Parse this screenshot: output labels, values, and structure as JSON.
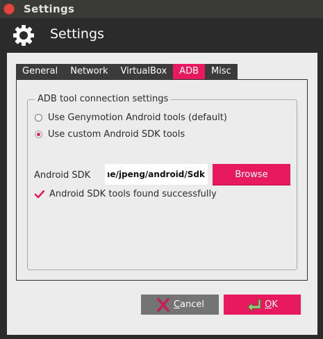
{
  "window": {
    "title": "Settings"
  },
  "header": {
    "title": "Settings",
    "icon": "gear-icon"
  },
  "tabs": [
    {
      "label": "General",
      "active": false
    },
    {
      "label": "Network",
      "active": false
    },
    {
      "label": "VirtualBox",
      "active": false
    },
    {
      "label": "ADB",
      "active": true
    },
    {
      "label": "Misc",
      "active": false
    }
  ],
  "adb": {
    "group_title": "ADB tool connection settings",
    "option_genymotion": "Use Genymotion Android tools (default)",
    "option_custom": "Use custom Android SDK tools",
    "selected_option": "custom",
    "sdk_label": "Android SDK",
    "sdk_path": "ome/jpeng/android/Sdk",
    "browse_label": "Browse",
    "status_text": "Android SDK tools found successfully"
  },
  "buttons": {
    "cancel_mnemonic": "C",
    "cancel_rest": "ancel",
    "ok_mnemonic": "O",
    "ok_rest": "K"
  },
  "colors": {
    "accent": "#e8195e",
    "title_bar": "#3a3a37",
    "header_bg": "#2b2b2b",
    "content_bg": "#ececec",
    "cancel_bg": "#747474"
  }
}
